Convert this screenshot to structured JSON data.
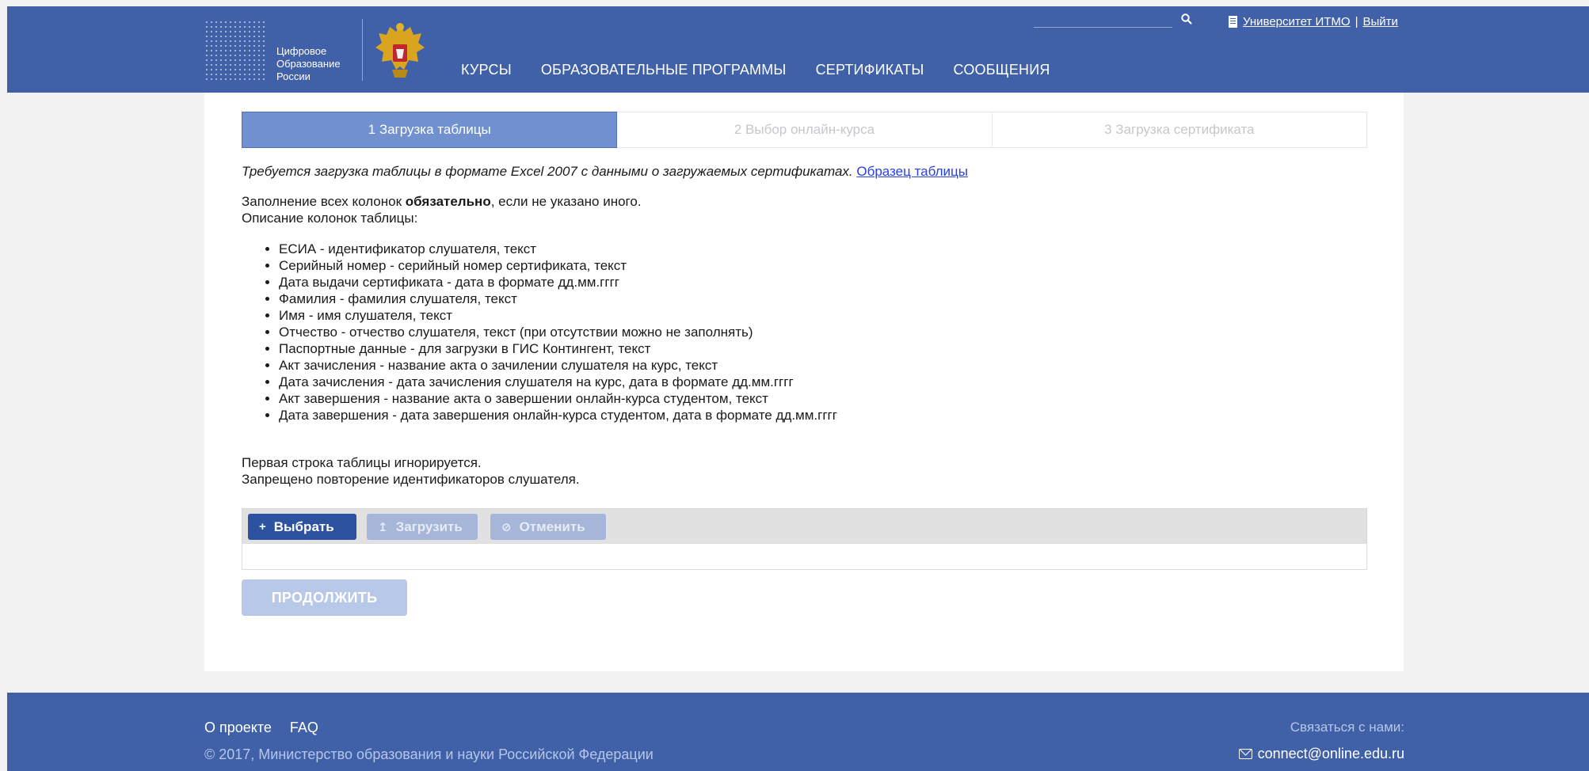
{
  "header": {
    "logo_lines": [
      "Цифровое",
      "Образование",
      "России"
    ],
    "nav": [
      "КУРСЫ",
      "ОБРАЗОВАТЕЛЬНЫЕ ПРОГРАММЫ",
      "СЕРТИФИКАТЫ",
      "СООБЩЕНИЯ"
    ],
    "search_icon": "search-icon",
    "university_link": "Университет ИТМО",
    "separator": "|",
    "logout_link": "Выйти"
  },
  "steps": [
    {
      "label": "1 Загрузка таблицы",
      "active": true
    },
    {
      "label": "2 Выбор онлайн-курса",
      "active": false
    },
    {
      "label": "3 Загрузка сертификата",
      "active": false
    }
  ],
  "content": {
    "intro_text": "Требуется загрузка таблицы в формате Excel 2007 с данными о загружаемых сертификатах. ",
    "sample_link": "Образец таблицы",
    "fill_prefix": "Заполнение всех колонок ",
    "fill_bold": "обязательно",
    "fill_suffix": ", если не указано иного.",
    "columns_heading": "Описание колонок таблицы:",
    "columns": [
      "ЕСИА - идентификатор слушателя, текст",
      "Серийный номер - серийный номер сертификата, текст",
      "Дата выдачи сертификата - дата в формате дд.мм.гггг",
      "Фамилия - фамилия слушателя, текст",
      "Имя - имя слушателя, текст",
      "Отчество - отчество слушателя, текст (при отсутствии можно не заполнять)",
      "Паспортные данные - для загрузки в ГИС Контингент, текст",
      "Акт зачисления - название акта о зачилении слушателя на курс, текст",
      "Дата зачисления - дата зачисления слушателя на курс, дата в формате дд.мм.гггг",
      "Акт завершения - название акта о завершении онлайн-курса студентом, текст",
      "Дата завершения - дата завершения онлайн-курса студентом, дата в формате дд.мм.гггг"
    ],
    "note_first_row": "Первая строка таблицы игнорируется.",
    "note_duplicates": "Запрещено повторение идентификаторов слушателя."
  },
  "upload": {
    "choose_icon": "+",
    "choose_label": "Выбрать",
    "upload_icon": "↥",
    "upload_label": "Загрузить",
    "cancel_icon": "⊘",
    "cancel_label": "Отменить"
  },
  "continue_label": "ПРОДОЛЖИТЬ",
  "footer": {
    "about": "О проекте",
    "faq": "FAQ",
    "copyright": "© 2017, Министерство образования и науки Российской Федерации",
    "contact_label": "Связаться с нами:",
    "email": "connect@online.edu.ru"
  },
  "colors": {
    "header_bg": "#4060a8",
    "active_step": "#7090d0",
    "primary_button": "#2c52a0",
    "link": "#2a40e0"
  }
}
